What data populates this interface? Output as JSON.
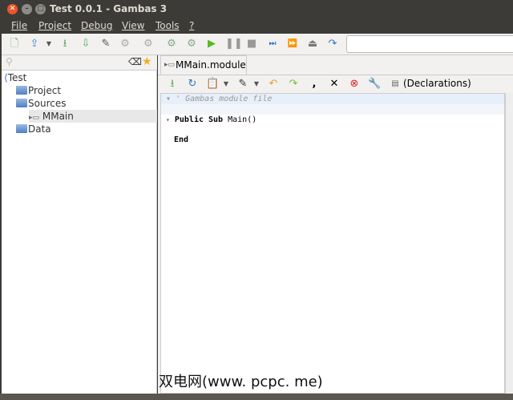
{
  "window": {
    "title": "Test 0.0.1 - Gambas 3"
  },
  "menu": [
    "File",
    "Project",
    "Debug",
    "View",
    "Tools",
    "?"
  ],
  "toolbar_icons": [
    "new-file-icon",
    "open-icon",
    "save-icon",
    "save-as-icon",
    "edit-icon",
    "gear-icon",
    "gears-icon",
    "compile-icon",
    "compile-all-icon",
    "play-icon",
    "pause-icon",
    "stop-icon",
    "step-icon",
    "forward-icon",
    "eject-icon",
    "redo-icon"
  ],
  "tree": {
    "root": "Test",
    "items": [
      "Project",
      "Sources",
      "MMain",
      "Data"
    ]
  },
  "tab": {
    "label": "MMain.module"
  },
  "editor_toolbar": {
    "declarations": "(Declarations)"
  },
  "code": {
    "comment": "' Gambas module file",
    "keywords": "Public Sub",
    "func": "Main()",
    "end": "End"
  },
  "watermark": "双电网(www. pcpc. me)"
}
